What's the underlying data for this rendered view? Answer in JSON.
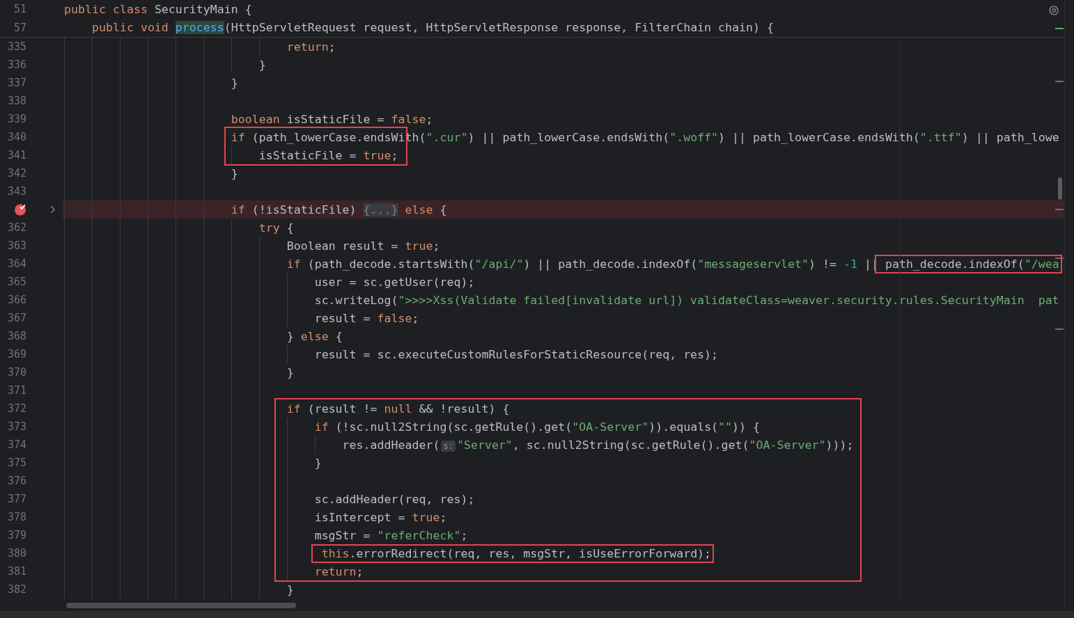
{
  "sticky_lines": [
    {
      "number": "51",
      "segments": [
        {
          "highlighted": false,
          "tokens": [
            {
              "kind": "kw",
              "text": "public class "
            },
            {
              "kind": "p",
              "text": "SecurityMain {"
            }
          ]
        }
      ]
    },
    {
      "number": "57",
      "segments": [
        {
          "highlighted": false,
          "tokens": [
            {
              "kind": "kw",
              "text": "    public void "
            },
            {
              "kind": "fn",
              "text": "process"
            },
            {
              "kind": "p",
              "text": "(HttpServletRequest request, HttpServletResponse response, FilterChain chain) {"
            }
          ]
        }
      ]
    }
  ],
  "lines": [
    {
      "number": "335",
      "breakpoint": false,
      "folded": false,
      "segments": [
        {
          "highlighted": false,
          "tokens": [
            {
              "kind": "kw",
              "text": "                                return"
            },
            {
              "kind": "p",
              "text": ";"
            }
          ]
        }
      ]
    },
    {
      "number": "336",
      "breakpoint": false,
      "folded": false,
      "segments": [
        {
          "highlighted": false,
          "tokens": [
            {
              "kind": "p",
              "text": "                            }"
            }
          ]
        }
      ]
    },
    {
      "number": "337",
      "breakpoint": false,
      "folded": false,
      "segments": [
        {
          "highlighted": false,
          "tokens": [
            {
              "kind": "p",
              "text": "                        }"
            }
          ]
        }
      ]
    },
    {
      "number": "338",
      "breakpoint": false,
      "folded": false
    },
    {
      "number": "339",
      "breakpoint": false,
      "folded": false,
      "segments": [
        {
          "highlighted": false,
          "tokens": [
            {
              "kind": "kw",
              "text": "                        boolean"
            },
            {
              "kind": "p",
              "text": " isStaticFile = "
            },
            {
              "kind": "kw",
              "text": "false"
            },
            {
              "kind": "p",
              "text": ";"
            }
          ]
        }
      ]
    },
    {
      "number": "340",
      "breakpoint": false,
      "folded": false,
      "segments": [
        {
          "highlighted": false,
          "tokens": [
            {
              "kind": "kw",
              "text": "                        if"
            },
            {
              "kind": "p",
              "text": " (path_lowerCase.endsWith("
            },
            {
              "kind": "s",
              "text": "\".cur\""
            },
            {
              "kind": "p",
              "text": ") || path_lowerCase.endsWith("
            },
            {
              "kind": "s",
              "text": "\".woff\""
            },
            {
              "kind": "p",
              "text": ") || path_lowerCase.endsWith("
            },
            {
              "kind": "s",
              "text": "\".ttf\""
            },
            {
              "kind": "p",
              "text": ") || path_lowe"
            }
          ]
        }
      ]
    },
    {
      "number": "341",
      "breakpoint": false,
      "folded": false,
      "segments": [
        {
          "highlighted": false,
          "tokens": [
            {
              "kind": "p",
              "text": "                            isStaticFile = "
            },
            {
              "kind": "kw",
              "text": "true"
            },
            {
              "kind": "p",
              "text": ";"
            }
          ]
        }
      ]
    },
    {
      "number": "342",
      "breakpoint": false,
      "folded": false,
      "segments": [
        {
          "highlighted": false,
          "tokens": [
            {
              "kind": "p",
              "text": "                        }"
            }
          ]
        }
      ]
    },
    {
      "number": "343",
      "breakpoint": false,
      "folded": false
    },
    {
      "breakpoint": true,
      "folded": true,
      "segments": [
        {
          "highlighted": false,
          "tokens": [
            {
              "kind": "kw",
              "text": "                        if"
            },
            {
              "kind": "p",
              "text": " (!isStaticFile) "
            },
            {
              "kind": "fold",
              "text": "{...}"
            },
            {
              "kind": "kw",
              "text": " else"
            },
            {
              "kind": "p",
              "text": " {"
            }
          ]
        }
      ]
    },
    {
      "number": "362",
      "breakpoint": false,
      "folded": false,
      "segments": [
        {
          "highlighted": false,
          "tokens": [
            {
              "kind": "kw",
              "text": "                            try"
            },
            {
              "kind": "p",
              "text": " {"
            }
          ]
        }
      ]
    },
    {
      "number": "363",
      "breakpoint": false,
      "folded": false,
      "segments": [
        {
          "highlighted": false,
          "tokens": [
            {
              "kind": "p",
              "text": "                                Boolean result = "
            },
            {
              "kind": "kw",
              "text": "true"
            },
            {
              "kind": "p",
              "text": ";"
            }
          ]
        }
      ]
    },
    {
      "number": "364",
      "breakpoint": false,
      "folded": false,
      "segments": [
        {
          "highlighted": false,
          "tokens": [
            {
              "kind": "kw",
              "text": "                                if"
            },
            {
              "kind": "p",
              "text": " (path_decode.startsWith("
            },
            {
              "kind": "s",
              "text": "\"/api/\""
            },
            {
              "kind": "p",
              "text": ") || path_decode.indexOf("
            },
            {
              "kind": "s",
              "text": "\"messageservlet\""
            },
            {
              "kind": "p",
              "text": ") != "
            },
            {
              "kind": "n",
              "text": "-1"
            },
            {
              "kind": "p",
              "text": " ||"
            }
          ]
        },
        {
          "highlighted": true,
          "tokens": [
            {
              "kind": "p",
              "text": "path_decode.indexOf("
            },
            {
              "kind": "s",
              "text": "\"/wea"
            }
          ]
        }
      ]
    },
    {
      "number": "365",
      "breakpoint": false,
      "folded": false,
      "segments": [
        {
          "highlighted": false,
          "tokens": [
            {
              "kind": "p",
              "text": "                                    user = sc.getUser(req);"
            }
          ]
        }
      ]
    },
    {
      "number": "366",
      "breakpoint": false,
      "folded": false,
      "segments": [
        {
          "highlighted": false,
          "tokens": [
            {
              "kind": "p",
              "text": "                                    sc.writeLog("
            },
            {
              "kind": "s",
              "text": "\">>>>Xss(Validate failed[invalidate url]) validateClass=weaver.security.rules.SecurityMain  pat"
            }
          ]
        }
      ]
    },
    {
      "number": "367",
      "breakpoint": false,
      "folded": false,
      "segments": [
        {
          "highlighted": false,
          "tokens": [
            {
              "kind": "p",
              "text": "                                    result = "
            },
            {
              "kind": "kw",
              "text": "false"
            },
            {
              "kind": "p",
              "text": ";"
            }
          ]
        }
      ]
    },
    {
      "number": "368",
      "breakpoint": false,
      "folded": false,
      "segments": [
        {
          "highlighted": false,
          "tokens": [
            {
              "kind": "p",
              "text": "                                } "
            },
            {
              "kind": "kw",
              "text": "else"
            },
            {
              "kind": "p",
              "text": " {"
            }
          ]
        }
      ]
    },
    {
      "number": "369",
      "breakpoint": false,
      "folded": false,
      "segments": [
        {
          "highlighted": false,
          "tokens": [
            {
              "kind": "p",
              "text": "                                    result = sc.executeCustomRulesForStaticResource(req, res);"
            }
          ]
        }
      ]
    },
    {
      "number": "370",
      "breakpoint": false,
      "folded": false,
      "segments": [
        {
          "highlighted": false,
          "tokens": [
            {
              "kind": "p",
              "text": "                                }"
            }
          ]
        }
      ]
    },
    {
      "number": "371",
      "breakpoint": false,
      "folded": false
    },
    {
      "number": "372",
      "breakpoint": false,
      "folded": false,
      "segments": [
        {
          "highlighted": false,
          "tokens": [
            {
              "kind": "kw",
              "text": "                                if"
            },
            {
              "kind": "p",
              "text": " (result != "
            },
            {
              "kind": "kw",
              "text": "null"
            },
            {
              "kind": "p",
              "text": " && !result) {"
            }
          ]
        }
      ]
    },
    {
      "number": "373",
      "breakpoint": false,
      "folded": false,
      "segments": [
        {
          "highlighted": false,
          "tokens": [
            {
              "kind": "kw",
              "text": "                                    if"
            },
            {
              "kind": "p",
              "text": " (!sc.null2String(sc.getRule().get("
            },
            {
              "kind": "s",
              "text": "\"OA-Server\""
            },
            {
              "kind": "p",
              "text": ")).equals("
            },
            {
              "kind": "s",
              "text": "\"\""
            },
            {
              "kind": "p",
              "text": ")) {"
            }
          ]
        }
      ]
    },
    {
      "number": "374",
      "breakpoint": false,
      "folded": false,
      "segments": [
        {
          "highlighted": false,
          "tokens": [
            {
              "kind": "p",
              "text": "                                        res.addHeader("
            },
            {
              "kind": "hint",
              "text": "s:"
            },
            {
              "kind": "s",
              "text": "\"Server\""
            },
            {
              "kind": "p",
              "text": ", sc.null2String(sc.getRule().get("
            },
            {
              "kind": "s",
              "text": "\"OA-Server\""
            },
            {
              "kind": "p",
              "text": ")));"
            }
          ]
        }
      ]
    },
    {
      "number": "375",
      "breakpoint": false,
      "folded": false,
      "segments": [
        {
          "highlighted": false,
          "tokens": [
            {
              "kind": "p",
              "text": "                                    }"
            }
          ]
        }
      ]
    },
    {
      "number": "376",
      "breakpoint": false,
      "folded": false
    },
    {
      "number": "377",
      "breakpoint": false,
      "folded": false,
      "segments": [
        {
          "highlighted": false,
          "tokens": [
            {
              "kind": "p",
              "text": "                                    sc.addHeader(req, res);"
            }
          ]
        }
      ]
    },
    {
      "number": "378",
      "breakpoint": false,
      "folded": false,
      "segments": [
        {
          "highlighted": false,
          "tokens": [
            {
              "kind": "p",
              "text": "                                    isIntercept = "
            },
            {
              "kind": "kw",
              "text": "true"
            },
            {
              "kind": "p",
              "text": ";"
            }
          ]
        }
      ]
    },
    {
      "number": "379",
      "breakpoint": false,
      "folded": false,
      "segments": [
        {
          "highlighted": false,
          "tokens": [
            {
              "kind": "p",
              "text": "                                    msgStr = "
            },
            {
              "kind": "s",
              "text": "\"referCheck\""
            },
            {
              "kind": "p",
              "text": ";"
            }
          ]
        }
      ]
    },
    {
      "number": "380",
      "breakpoint": false,
      "folded": false,
      "segments": [
        {
          "highlighted": true,
          "tokens": [
            {
              "kind": "kw",
              "text": "                                    this"
            },
            {
              "kind": "p",
              "text": ".errorRedirect(req, res, msgStr, isUseErrorForward);"
            }
          ]
        }
      ]
    },
    {
      "number": "381",
      "breakpoint": false,
      "folded": false,
      "segments": [
        {
          "highlighted": false,
          "tokens": [
            {
              "kind": "kw",
              "text": "                                    return"
            },
            {
              "kind": "p",
              "text": ";"
            }
          ]
        }
      ]
    },
    {
      "number": "382",
      "breakpoint": false,
      "folded": false,
      "segments": [
        {
          "highlighted": false,
          "tokens": [
            {
              "kind": "p",
              "text": "                                }"
            }
          ]
        }
      ]
    }
  ]
}
